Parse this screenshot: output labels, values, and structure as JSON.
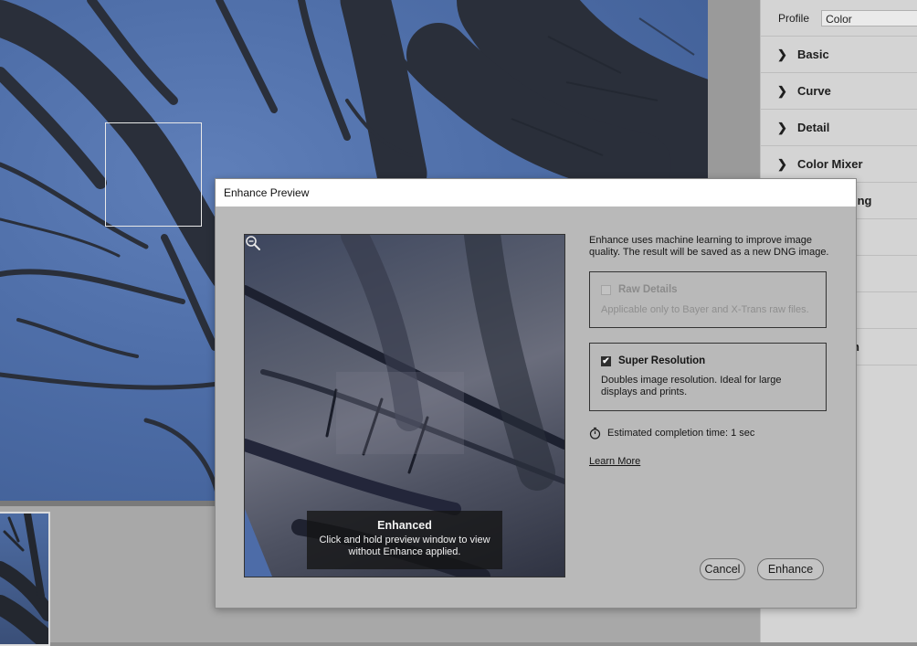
{
  "panel": {
    "profile_label": "Profile",
    "profile_value": "Color",
    "sections": [
      {
        "label": "Basic"
      },
      {
        "label": "Curve"
      },
      {
        "label": "Detail"
      },
      {
        "label": "Color Mixer"
      },
      {
        "label": "ing"
      },
      {
        "label": ""
      },
      {
        "label": ""
      },
      {
        "label": ""
      },
      {
        "label": "n"
      }
    ],
    "chevron_icon": "chevron-right-icon"
  },
  "dialog": {
    "title": "Enhance Preview",
    "description": "Enhance uses machine learning to improve image quality. The result will be saved as a new DNG image.",
    "raw_details": {
      "label": "Raw Details",
      "checked": false,
      "enabled": false,
      "description": "Applicable only to Bayer and X-Trans raw files."
    },
    "super_resolution": {
      "label": "Super Resolution",
      "checked": true,
      "enabled": true,
      "description": "Doubles image resolution. Ideal for large displays and prints."
    },
    "estimate": "Estimated completion time: 1 sec",
    "learn_more": "Learn More",
    "preview_overlay": {
      "title": "Enhanced",
      "hint": "Click and hold preview window to view without Enhance applied."
    },
    "cancel_label": "Cancel",
    "enhance_label": "Enhance"
  },
  "icons": {
    "zoom": "zoom-out-icon",
    "timer": "stopwatch-icon",
    "checkmark": "checkmark-icon"
  }
}
